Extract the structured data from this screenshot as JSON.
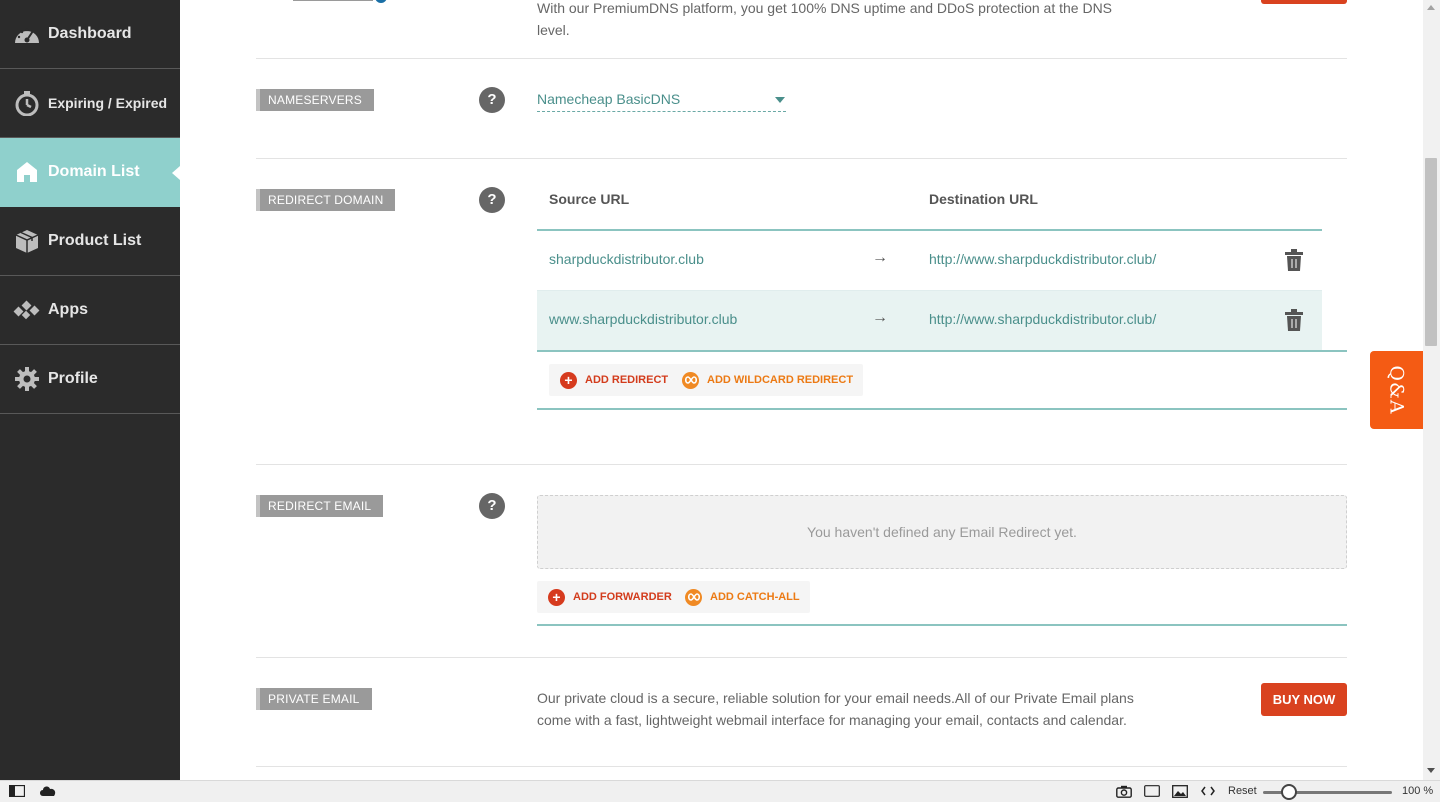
{
  "sidebar": {
    "items": [
      {
        "label": "Dashboard",
        "icon": "speedometer-icon"
      },
      {
        "label": "Expiring / Expired",
        "icon": "stopwatch-icon"
      },
      {
        "label": "Domain List",
        "icon": "home-icon",
        "active": true
      },
      {
        "label": "Product List",
        "icon": "box-icon"
      },
      {
        "label": "Apps",
        "icon": "apps-diamond-icon"
      },
      {
        "label": "Profile",
        "icon": "gear-icon"
      }
    ]
  },
  "premium_dns": {
    "description": "With our PremiumDNS platform, you get 100% DNS uptime and DDoS protection at the DNS level."
  },
  "nameservers": {
    "tag": "NAMESERVERS",
    "selected": "Namecheap BasicDNS"
  },
  "redirect_domain": {
    "tag": "REDIRECT DOMAIN",
    "col_source": "Source URL",
    "col_destination": "Destination URL",
    "rows": [
      {
        "source": "sharpduckdistributor.club",
        "arrow": "→",
        "destination": "http://www.sharpduckdistributor.club/"
      },
      {
        "source": "www.sharpduckdistributor.club",
        "arrow": "→",
        "destination": "http://www.sharpduckdistributor.club/"
      }
    ],
    "add_redirect": "ADD REDIRECT",
    "add_wildcard": "ADD WILDCARD REDIRECT"
  },
  "redirect_email": {
    "tag": "REDIRECT EMAIL",
    "empty_message": "You haven't defined any Email Redirect yet.",
    "add_forwarder": "ADD FORWARDER",
    "add_catch_all": "ADD CATCH-ALL"
  },
  "private_email": {
    "tag": "PRIVATE EMAIL",
    "description": "Our private cloud is a secure, reliable solution for your email needs.All of our Private Email plans come with a fast, lightweight webmail interface for managing your email, contacts and calendar.",
    "buy_label": "BUY NOW"
  },
  "help_symbol": "?",
  "qa_tab": "Q&A",
  "statusbar": {
    "reset_label": "Reset",
    "zoom": "100 %"
  },
  "colors": {
    "sidebar_bg": "#2b2b2b",
    "active_item": "#8fd0cc",
    "teal_text": "#4a8f8b",
    "buy_button": "#d9421f",
    "qa_tab": "#f45b14"
  }
}
